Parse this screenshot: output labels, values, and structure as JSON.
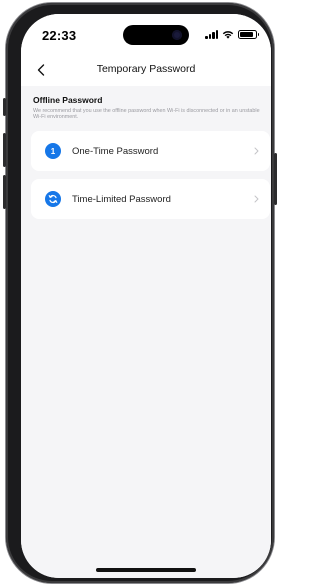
{
  "status_bar": {
    "time": "22:33",
    "battery_level": 0.85,
    "icons": [
      "signal-icon",
      "wifi-icon",
      "battery-icon"
    ]
  },
  "nav": {
    "title": "Temporary Password",
    "back_icon": "chevron-left-icon"
  },
  "section": {
    "title": "Offline Password",
    "description": "We recommend that you use the offline password when Wi-Fi is disconnected or in an unstable Wi-Fi environment."
  },
  "options": [
    {
      "label": "One-Time Password",
      "icon": "number-one-icon",
      "icon_text": "1",
      "chevron": "chevron-right-icon"
    },
    {
      "label": "Time-Limited Password",
      "icon": "refresh-cycle-icon",
      "chevron": "chevron-right-icon"
    }
  ],
  "colors": {
    "accent": "#1677e8",
    "background": "#f5f5f7",
    "card": "#ffffff",
    "text_primary": "#222222",
    "text_secondary": "#9a9aa0"
  }
}
